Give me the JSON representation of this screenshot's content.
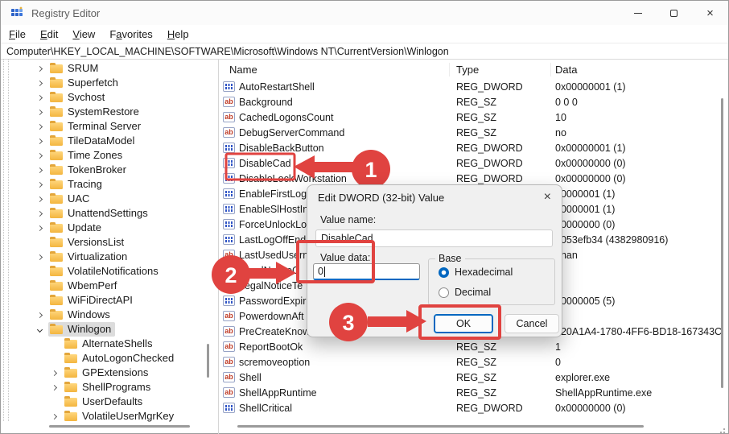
{
  "window": {
    "title": "Registry Editor",
    "minimize": "",
    "maximize": "",
    "close": "×"
  },
  "menu": {
    "items": [
      {
        "pre": "",
        "accel": "F",
        "post": "ile"
      },
      {
        "pre": "",
        "accel": "E",
        "post": "dit"
      },
      {
        "pre": "",
        "accel": "V",
        "post": "iew"
      },
      {
        "pre": "F",
        "accel": "a",
        "post": "vorites"
      },
      {
        "pre": "",
        "accel": "H",
        "post": "elp"
      }
    ]
  },
  "address": {
    "path": "Computer\\HKEY_LOCAL_MACHINE\\SOFTWARE\\Microsoft\\Windows NT\\CurrentVersion\\Winlogon"
  },
  "tree": {
    "items": [
      {
        "label": "SRUM",
        "chev": "right",
        "level": 0
      },
      {
        "label": "Superfetch",
        "chev": "right",
        "level": 0
      },
      {
        "label": "Svchost",
        "chev": "right",
        "level": 0
      },
      {
        "label": "SystemRestore",
        "chev": "right",
        "level": 0
      },
      {
        "label": "Terminal Server",
        "chev": "right",
        "level": 0
      },
      {
        "label": "TileDataModel",
        "chev": "right",
        "level": 0
      },
      {
        "label": "Time Zones",
        "chev": "right",
        "level": 0
      },
      {
        "label": "TokenBroker",
        "chev": "right",
        "level": 0
      },
      {
        "label": "Tracing",
        "chev": "right",
        "level": 0
      },
      {
        "label": "UAC",
        "chev": "right",
        "level": 0
      },
      {
        "label": "UnattendSettings",
        "chev": "right",
        "level": 0
      },
      {
        "label": "Update",
        "chev": "right",
        "level": 0
      },
      {
        "label": "VersionsList",
        "chev": "none",
        "level": 0
      },
      {
        "label": "Virtualization",
        "chev": "right",
        "level": 0
      },
      {
        "label": "VolatileNotifications",
        "chev": "none",
        "level": 0
      },
      {
        "label": "WbemPerf",
        "chev": "none",
        "level": 0
      },
      {
        "label": "WiFiDirectAPI",
        "chev": "none",
        "level": 0
      },
      {
        "label": "Windows",
        "chev": "right",
        "level": 0
      },
      {
        "label": "Winlogon",
        "chev": "down",
        "level": 0,
        "selected": true
      },
      {
        "label": "AlternateShells",
        "chev": "none",
        "level": 1
      },
      {
        "label": "AutoLogonChecked",
        "chev": "none",
        "level": 1
      },
      {
        "label": "GPExtensions",
        "chev": "right",
        "level": 1
      },
      {
        "label": "ShellPrograms",
        "chev": "right",
        "level": 1
      },
      {
        "label": "UserDefaults",
        "chev": "none",
        "level": 1
      },
      {
        "label": "VolatileUserMgrKey",
        "chev": "right",
        "level": 1
      }
    ]
  },
  "list": {
    "columns": [
      "Name",
      "Type",
      "Data"
    ],
    "rows": [
      {
        "name": "AutoRestartShell",
        "icon": "dword",
        "type": "REG_DWORD",
        "data": "0x00000001 (1)"
      },
      {
        "name": "Background",
        "icon": "sz",
        "type": "REG_SZ",
        "data": "0 0 0"
      },
      {
        "name": "CachedLogonsCount",
        "icon": "sz",
        "type": "REG_SZ",
        "data": "10"
      },
      {
        "name": "DebugServerCommand",
        "icon": "sz",
        "type": "REG_SZ",
        "data": "no"
      },
      {
        "name": "DisableBackButton",
        "icon": "dword",
        "type": "REG_DWORD",
        "data": "0x00000001 (1)"
      },
      {
        "name": "DisableCad",
        "icon": "dword",
        "type": "REG_DWORD",
        "data": "0x00000000 (0)"
      },
      {
        "name": "DisableLockWorkstation",
        "icon": "dword",
        "type": "REG_DWORD",
        "data": "0x00000000 (0)"
      },
      {
        "name": "EnableFirstLog",
        "icon": "dword",
        "type": "",
        "data": "00000001 (1)"
      },
      {
        "name": "EnableSlHostIn",
        "icon": "dword",
        "type": "",
        "data": "00000001 (1)"
      },
      {
        "name": "ForceUnlockLo",
        "icon": "dword",
        "type": "",
        "data": "00000000 (0)"
      },
      {
        "name": "LastLogOffEnd",
        "icon": "dword",
        "type": "",
        "data": "1053efb34 (4382980916)"
      },
      {
        "name": "LastUsedUsern",
        "icon": "sz",
        "type": "",
        "data": "bhan"
      },
      {
        "name": "LegalNoticeC",
        "icon": "sz",
        "type": "",
        "data": ""
      },
      {
        "name": "LegalNoticeTe",
        "icon": "sz",
        "type": "",
        "data": ""
      },
      {
        "name": "PasswordExpir",
        "icon": "dword",
        "type": "",
        "data": "00000005 (5)"
      },
      {
        "name": "PowerdownAft",
        "icon": "sz",
        "type": "",
        "data": ""
      },
      {
        "name": "PreCreateKnow",
        "icon": "sz",
        "type": "",
        "data": "520A1A4-1780-4FF6-BD18-167343C"
      },
      {
        "name": "ReportBootOk",
        "icon": "sz",
        "type": "REG_SZ",
        "data": "1"
      },
      {
        "name": "scremoveoption",
        "icon": "sz",
        "type": "REG_SZ",
        "data": "0"
      },
      {
        "name": "Shell",
        "icon": "sz",
        "type": "REG_SZ",
        "data": "explorer.exe"
      },
      {
        "name": "ShellAppRuntime",
        "icon": "sz",
        "type": "REG_SZ",
        "data": "ShellAppRuntime.exe"
      },
      {
        "name": "ShellCritical",
        "icon": "dword",
        "type": "REG_DWORD",
        "data": "0x00000000 (0)"
      }
    ]
  },
  "dialog": {
    "title": "Edit DWORD (32-bit) Value",
    "close": "×",
    "value_name_label": "Value name:",
    "value_name": "DisableCad",
    "value_data_label": "Value data:",
    "value_data": "0",
    "base_label": "Base",
    "radio_hex": "Hexadecimal",
    "radio_dec": "Decimal",
    "ok": "OK",
    "cancel": "Cancel"
  },
  "annotations": {
    "step1": "1",
    "step2": "2",
    "step3": "3"
  },
  "colors": {
    "accent": "#0067c0",
    "annotation_red": "#e04340",
    "folder_yellow": "#f3b53f",
    "selection_gray": "#dcdcdc"
  }
}
